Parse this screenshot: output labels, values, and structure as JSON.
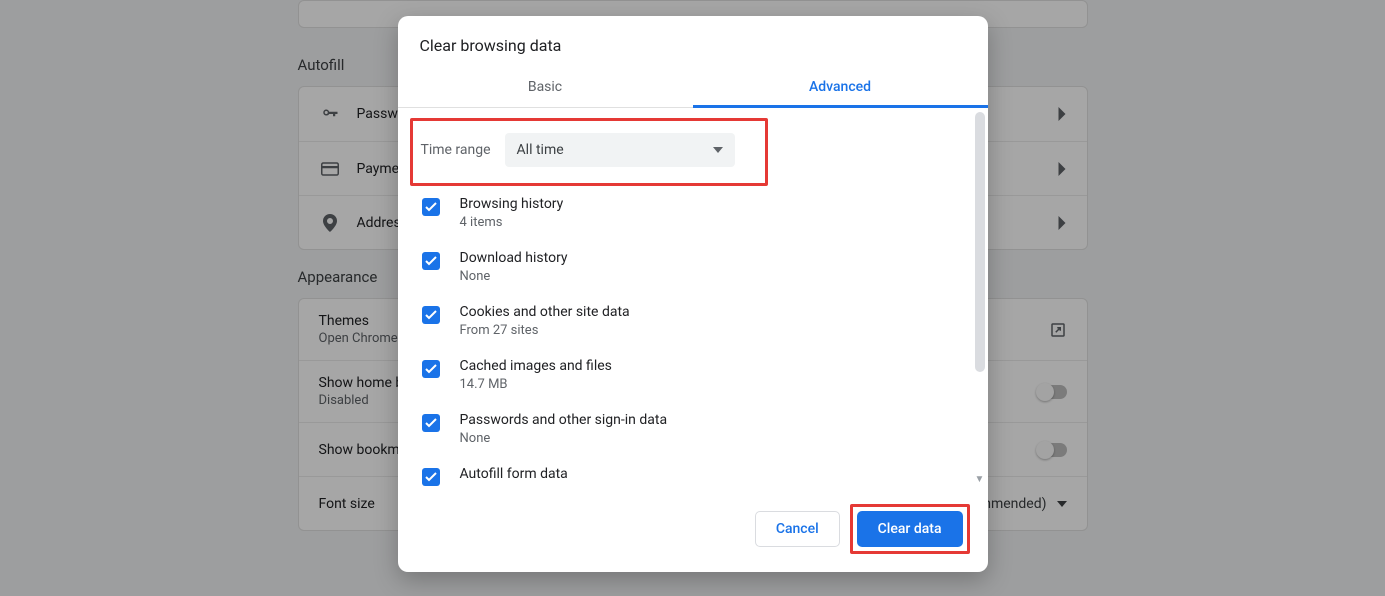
{
  "background": {
    "autofill_title": "Autofill",
    "autofill_rows": [
      {
        "label": "Passwords",
        "icon": "key"
      },
      {
        "label": "Payment methods",
        "icon": "card"
      },
      {
        "label": "Addresses and more",
        "icon": "pin"
      }
    ],
    "appearance_title": "Appearance",
    "appearance_rows": {
      "themes_label": "Themes",
      "themes_sub": "Open Chrome Web Store",
      "show_home_label": "Show home button",
      "show_home_sub": "Disabled",
      "show_bookmarks_label": "Show bookmarks bar",
      "font_size_label": "Font size",
      "font_size_value": "Medium (Recommended)"
    }
  },
  "dialog": {
    "title": "Clear browsing data",
    "tabs": {
      "basic": "Basic",
      "advanced": "Advanced"
    },
    "time_range_label": "Time range",
    "time_range_value": "All time",
    "items": [
      {
        "label": "Browsing history",
        "sub": "4 items"
      },
      {
        "label": "Download history",
        "sub": "None"
      },
      {
        "label": "Cookies and other site data",
        "sub": "From 27 sites"
      },
      {
        "label": "Cached images and files",
        "sub": "14.7 MB"
      },
      {
        "label": "Passwords and other sign-in data",
        "sub": "None"
      },
      {
        "label": "Autofill form data",
        "sub": ""
      }
    ],
    "cancel": "Cancel",
    "clear": "Clear data"
  }
}
